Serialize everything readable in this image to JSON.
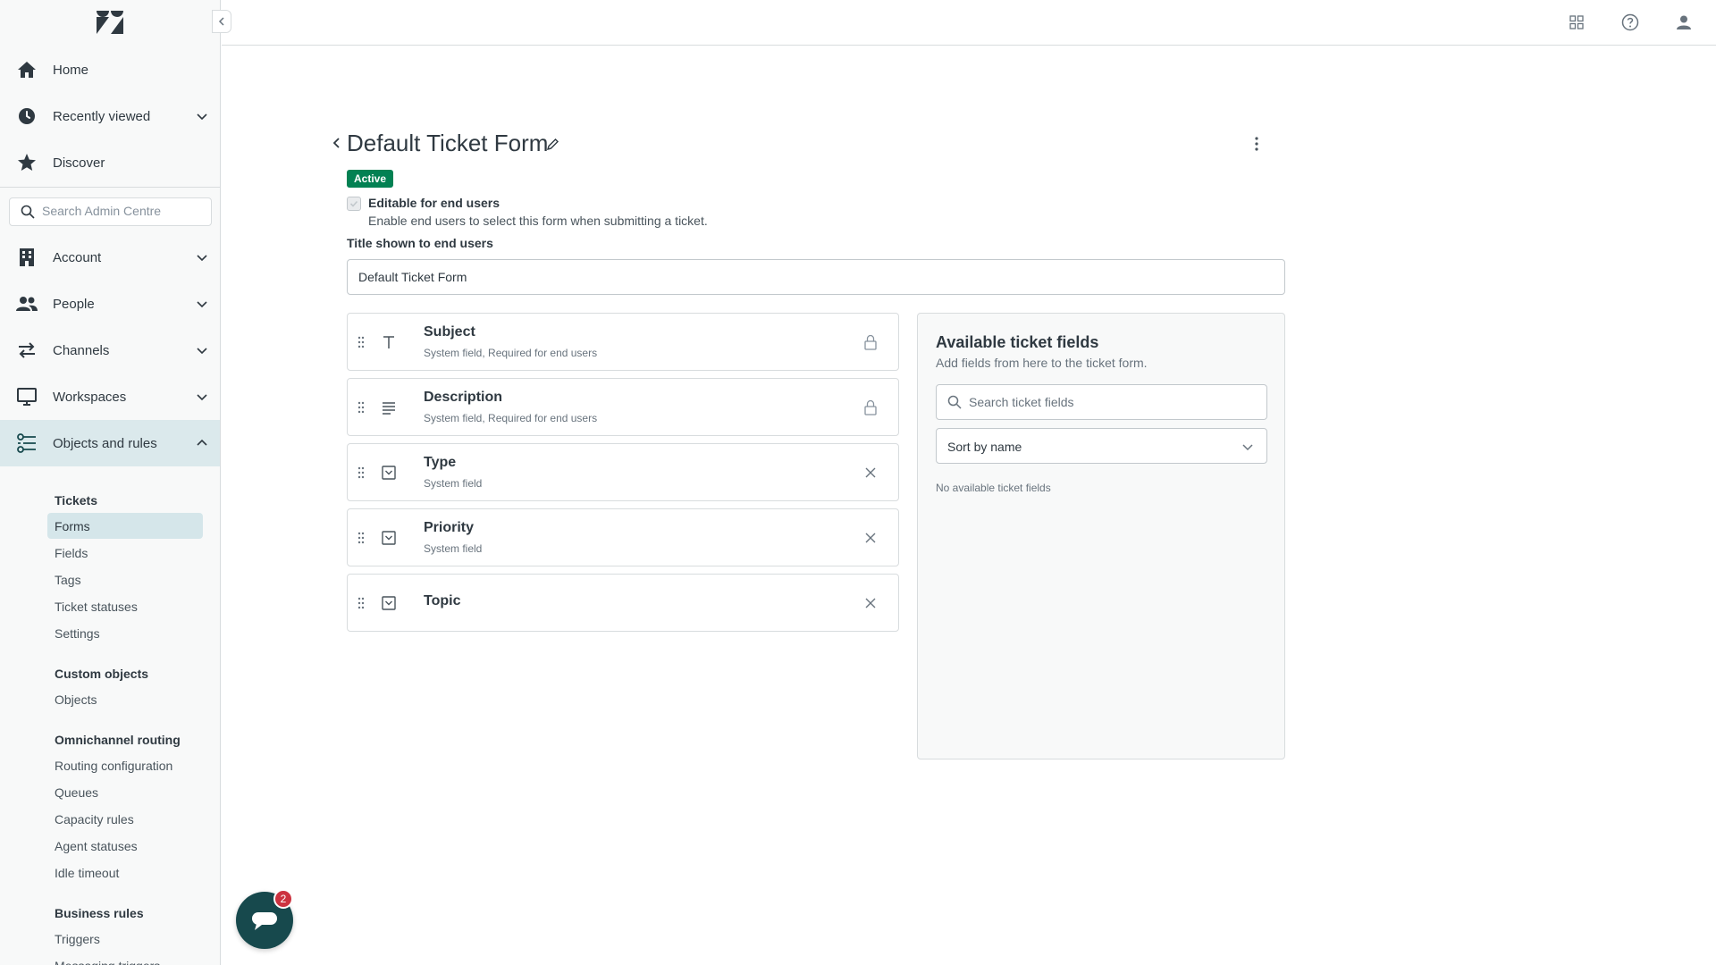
{
  "sidebar": {
    "collapse_label": "Collapse navigation",
    "primary": [
      {
        "label": "Home",
        "icon": "home-icon"
      },
      {
        "label": "Recently viewed",
        "icon": "clock-icon"
      },
      {
        "label": "Discover",
        "icon": "star-icon"
      }
    ],
    "search": {
      "placeholder": "Search Admin Centre"
    },
    "sections": [
      {
        "label": "Account",
        "icon": "building-icon"
      },
      {
        "label": "People",
        "icon": "people-icon"
      },
      {
        "label": "Channels",
        "icon": "channels-icon"
      },
      {
        "label": "Workspaces",
        "icon": "monitor-icon"
      },
      {
        "label": "Objects and rules",
        "icon": "objects-icon"
      }
    ],
    "submenu": {
      "tickets": {
        "heading": "Tickets",
        "items": [
          "Forms",
          "Fields",
          "Tags",
          "Ticket statuses",
          "Settings"
        ]
      },
      "custom_objects": {
        "heading": "Custom objects",
        "items": [
          "Objects"
        ]
      },
      "omnichannel": {
        "heading": "Omnichannel routing",
        "items": [
          "Routing configuration",
          "Queues",
          "Capacity rules",
          "Agent statuses",
          "Idle timeout"
        ]
      },
      "business_rules": {
        "heading": "Business rules",
        "items": [
          "Triggers",
          "Messaging triggers"
        ]
      }
    }
  },
  "page": {
    "title": "Default Ticket Form",
    "status": "Active",
    "editable_label": "Editable for end users",
    "editable_hint": "Enable end users to select this form when submitting a ticket.",
    "title_field_label": "Title shown to end users",
    "title_field_value": "Default Ticket Form"
  },
  "form_fields": [
    {
      "name": "Subject",
      "desc": "System field, Required for end users",
      "type_icon": "text-icon",
      "action": "lock-icon"
    },
    {
      "name": "Description",
      "desc": "System field, Required for end users",
      "type_icon": "paragraph-icon",
      "action": "lock-icon"
    },
    {
      "name": "Type",
      "desc": "System field",
      "type_icon": "dropdown-field-icon",
      "action": "remove-icon"
    },
    {
      "name": "Priority",
      "desc": "System field",
      "type_icon": "dropdown-field-icon",
      "action": "remove-icon"
    },
    {
      "name": "Topic",
      "desc": "",
      "type_icon": "dropdown-field-icon",
      "action": "remove-icon"
    }
  ],
  "available": {
    "title": "Available ticket fields",
    "subtitle": "Add fields from here to the ticket form.",
    "search_placeholder": "Search ticket fields",
    "sort_value": "Sort by name",
    "empty_text": "No available ticket fields"
  },
  "chat": {
    "badge_count": "2"
  },
  "colors": {
    "accent": "#038153",
    "active_nav": "#dbe9ec",
    "chat": "#17494d",
    "badge": "#cc3340"
  }
}
